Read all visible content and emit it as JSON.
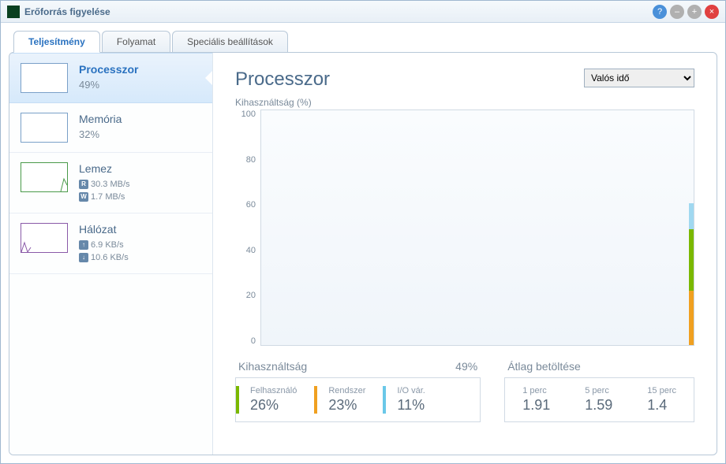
{
  "window": {
    "title": "Erőforrás figyelése"
  },
  "tabs": [
    {
      "label": "Teljesítmény",
      "active": true
    },
    {
      "label": "Folyamat",
      "active": false
    },
    {
      "label": "Speciális beállítások",
      "active": false
    }
  ],
  "sidebar": {
    "cpu": {
      "title": "Processzor",
      "value": "49%"
    },
    "mem": {
      "title": "Memória",
      "value": "32%"
    },
    "disk": {
      "title": "Lemez",
      "read_badge": "R",
      "read": "30.3 MB/s",
      "write_badge": "W",
      "write": "1.7 MB/s"
    },
    "net": {
      "title": "Hálózat",
      "up_badge": "↑",
      "up": "6.9 KB/s",
      "down_badge": "↓",
      "down": "10.6 KB/s"
    }
  },
  "main": {
    "title": "Processzor",
    "time_select": "Valós idő",
    "chart_ylabel": "Kihasználtság (%)",
    "util_title": "Kihasználtság",
    "util_total": "49%",
    "user_label": "Felhasználó",
    "user_value": "26%",
    "sys_label": "Rendszer",
    "sys_value": "23%",
    "io_label": "I/O vár.",
    "io_value": "11%",
    "load_title": "Átlag betöltése",
    "l1_label": "1 perc",
    "l1_value": "1.91",
    "l5_label": "5 perc",
    "l5_value": "1.59",
    "l15_label": "15 perc",
    "l15_value": "1.4"
  },
  "chart_data": {
    "type": "area",
    "title": "Kihasználtság (%)",
    "ylim": [
      0,
      100
    ],
    "yticks": [
      0,
      20,
      40,
      60,
      80,
      100
    ],
    "series": [
      {
        "name": "Felhasználó",
        "color": "#7ab800",
        "latest": 26
      },
      {
        "name": "Rendszer",
        "color": "#f0a020",
        "latest": 23
      },
      {
        "name": "I/O vár.",
        "color": "#6ac8e8",
        "latest": 11
      }
    ],
    "note": "Only the rightmost instantaneous stacked values are visible on the chart"
  }
}
